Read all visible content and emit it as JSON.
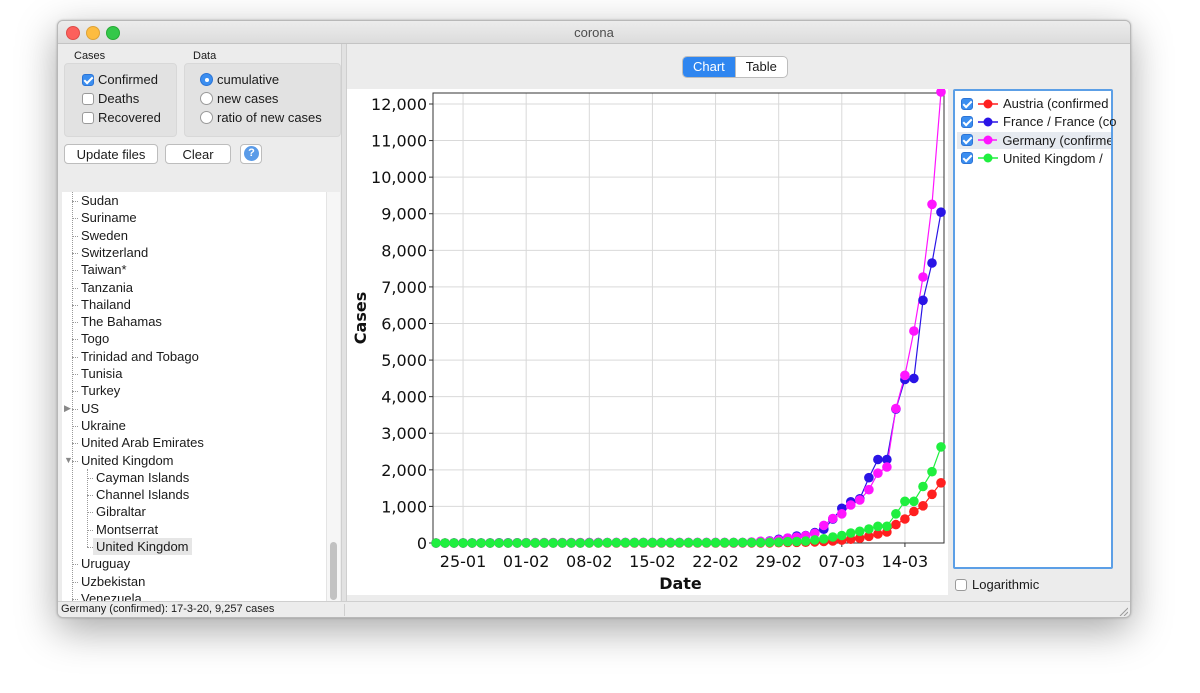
{
  "window": {
    "title": "corona"
  },
  "cases_group": {
    "label": "Cases",
    "options": [
      {
        "label": "Confirmed",
        "checked": true
      },
      {
        "label": "Deaths",
        "checked": false
      },
      {
        "label": "Recovered",
        "checked": false
      }
    ]
  },
  "data_group": {
    "label": "Data",
    "options": [
      {
        "label": "cumulative",
        "selected": true
      },
      {
        "label": "new cases",
        "selected": false
      },
      {
        "label": "ratio of new cases",
        "selected": false
      }
    ]
  },
  "buttons": {
    "update": "Update files",
    "clear": "Clear",
    "help": "?"
  },
  "tree": {
    "items": [
      {
        "label": "Sudan",
        "level": 0
      },
      {
        "label": "Suriname",
        "level": 0
      },
      {
        "label": "Sweden",
        "level": 0
      },
      {
        "label": "Switzerland",
        "level": 0
      },
      {
        "label": "Taiwan*",
        "level": 0
      },
      {
        "label": "Tanzania",
        "level": 0
      },
      {
        "label": "Thailand",
        "level": 0
      },
      {
        "label": "The Bahamas",
        "level": 0
      },
      {
        "label": "Togo",
        "level": 0
      },
      {
        "label": "Trinidad and Tobago",
        "level": 0
      },
      {
        "label": "Tunisia",
        "level": 0
      },
      {
        "label": "Turkey",
        "level": 0
      },
      {
        "label": "US",
        "level": 0,
        "expander": "collapsed"
      },
      {
        "label": "Ukraine",
        "level": 0
      },
      {
        "label": "United Arab Emirates",
        "level": 0
      },
      {
        "label": "United Kingdom",
        "level": 0,
        "expander": "expanded"
      },
      {
        "label": "Cayman Islands",
        "level": 1
      },
      {
        "label": "Channel Islands",
        "level": 1
      },
      {
        "label": "Gibraltar",
        "level": 1
      },
      {
        "label": "Montserrat",
        "level": 1
      },
      {
        "label": "United Kingdom",
        "level": 1,
        "selected": true
      },
      {
        "label": "Uruguay",
        "level": 0
      },
      {
        "label": "Uzbekistan",
        "level": 0
      },
      {
        "label": "Venezuela",
        "level": 0
      }
    ]
  },
  "tabs": {
    "chart": "Chart",
    "table": "Table",
    "active": "chart"
  },
  "legend": {
    "items": [
      {
        "label": "Austria (confirmed",
        "checked": true,
        "color": "#ff1f1f"
      },
      {
        "label": "France / France (co",
        "checked": true,
        "color": "#2a14e6"
      },
      {
        "label": "Germany (confirme",
        "checked": true,
        "color": "#ff14ff",
        "selected": true
      },
      {
        "label": "United Kingdom /",
        "checked": true,
        "color": "#1fef3f"
      }
    ],
    "logarithmic_label": "Logarithmic",
    "logarithmic_checked": false
  },
  "status": {
    "text": "Germany (confirmed): 17-3-20, 9,257 cases"
  },
  "chart_data": {
    "type": "line",
    "xlabel": "Date",
    "ylabel": "Cases",
    "ylim": [
      0,
      12300
    ],
    "yticks": [
      0,
      1000,
      2000,
      3000,
      4000,
      5000,
      6000,
      7000,
      8000,
      9000,
      10000,
      11000,
      12000
    ],
    "ytick_labels": [
      "0",
      "1,000",
      "2,000",
      "3,000",
      "4,000",
      "5,000",
      "6,000",
      "7,000",
      "8,000",
      "9,000",
      "10,000",
      "11,000",
      "12,000"
    ],
    "xticks": [
      3,
      10,
      17,
      24,
      31,
      38,
      45,
      52
    ],
    "xtick_labels": [
      "25-01",
      "01-02",
      "08-02",
      "15-02",
      "22-02",
      "29-02",
      "07-03",
      "14-03"
    ],
    "x": [
      0,
      1,
      2,
      3,
      4,
      5,
      6,
      7,
      8,
      9,
      10,
      11,
      12,
      13,
      14,
      15,
      16,
      17,
      18,
      19,
      20,
      21,
      22,
      23,
      24,
      25,
      26,
      27,
      28,
      29,
      30,
      31,
      32,
      33,
      34,
      35,
      36,
      37,
      38,
      39,
      40,
      41,
      42,
      43,
      44,
      45,
      46,
      47,
      48,
      49,
      50,
      51,
      52,
      53,
      54,
      55,
      56
    ],
    "x_dates": [
      "22-01",
      "23-01",
      "24-01",
      "25-01",
      "26-01",
      "27-01",
      "28-01",
      "29-01",
      "30-01",
      "31-01",
      "01-02",
      "02-02",
      "03-02",
      "04-02",
      "05-02",
      "06-02",
      "07-02",
      "08-02",
      "09-02",
      "10-02",
      "11-02",
      "12-02",
      "13-02",
      "14-02",
      "15-02",
      "16-02",
      "17-02",
      "18-02",
      "19-02",
      "20-02",
      "21-02",
      "22-02",
      "23-02",
      "24-02",
      "25-02",
      "26-02",
      "27-02",
      "28-02",
      "29-02",
      "01-03",
      "02-03",
      "03-03",
      "04-03",
      "05-03",
      "06-03",
      "07-03",
      "08-03",
      "09-03",
      "10-03",
      "11-03",
      "12-03",
      "13-03",
      "14-03",
      "15-03",
      "16-03",
      "17-03",
      "18-03"
    ],
    "series": [
      {
        "name": "Austria (confirmed",
        "color": "#ff1f1f",
        "values": [
          0,
          0,
          0,
          0,
          0,
          0,
          0,
          0,
          0,
          0,
          0,
          0,
          0,
          0,
          0,
          0,
          0,
          0,
          0,
          0,
          0,
          0,
          0,
          0,
          0,
          0,
          0,
          0,
          0,
          0,
          0,
          0,
          0,
          0,
          2,
          2,
          3,
          3,
          9,
          14,
          18,
          21,
          29,
          41,
          55,
          79,
          104,
          131,
          182,
          246,
          302,
          504,
          655,
          860,
          1018,
          1332,
          1646
        ]
      },
      {
        "name": "France / France (co",
        "color": "#2a14e6",
        "values": [
          0,
          0,
          2,
          3,
          3,
          3,
          4,
          5,
          5,
          5,
          6,
          6,
          6,
          6,
          6,
          6,
          6,
          11,
          11,
          11,
          11,
          11,
          11,
          11,
          12,
          12,
          12,
          12,
          12,
          12,
          12,
          12,
          12,
          12,
          14,
          18,
          38,
          57,
          100,
          130,
          191,
          204,
          285,
          377,
          653,
          949,
          1126,
          1209,
          1784,
          2281,
          2281,
          3661,
          4469,
          4499,
          6633,
          7652,
          9043
        ]
      },
      {
        "name": "Germany (confirme",
        "color": "#ff14ff",
        "values": [
          0,
          0,
          0,
          0,
          0,
          1,
          4,
          4,
          4,
          5,
          8,
          10,
          12,
          12,
          12,
          12,
          13,
          13,
          14,
          14,
          16,
          16,
          16,
          16,
          16,
          16,
          16,
          16,
          16,
          16,
          16,
          16,
          16,
          16,
          17,
          27,
          46,
          48,
          79,
          130,
          159,
          196,
          262,
          482,
          670,
          799,
          1040,
          1176,
          1457,
          1908,
          2078,
          3675,
          4585,
          5795,
          7272,
          9257,
          12327
        ]
      },
      {
        "name": "United Kingdom /",
        "color": "#1fef3f",
        "values": [
          0,
          0,
          0,
          0,
          0,
          0,
          0,
          0,
          0,
          2,
          2,
          2,
          2,
          2,
          2,
          2,
          2,
          3,
          3,
          8,
          8,
          9,
          9,
          9,
          9,
          9,
          9,
          9,
          9,
          9,
          9,
          9,
          9,
          13,
          13,
          13,
          15,
          20,
          23,
          36,
          40,
          51,
          85,
          115,
          163,
          206,
          273,
          321,
          382,
          456,
          456,
          798,
          1140,
          1140,
          1543,
          1950,
          2626
        ]
      }
    ],
    "grid": true,
    "legend_position": "right panel"
  }
}
